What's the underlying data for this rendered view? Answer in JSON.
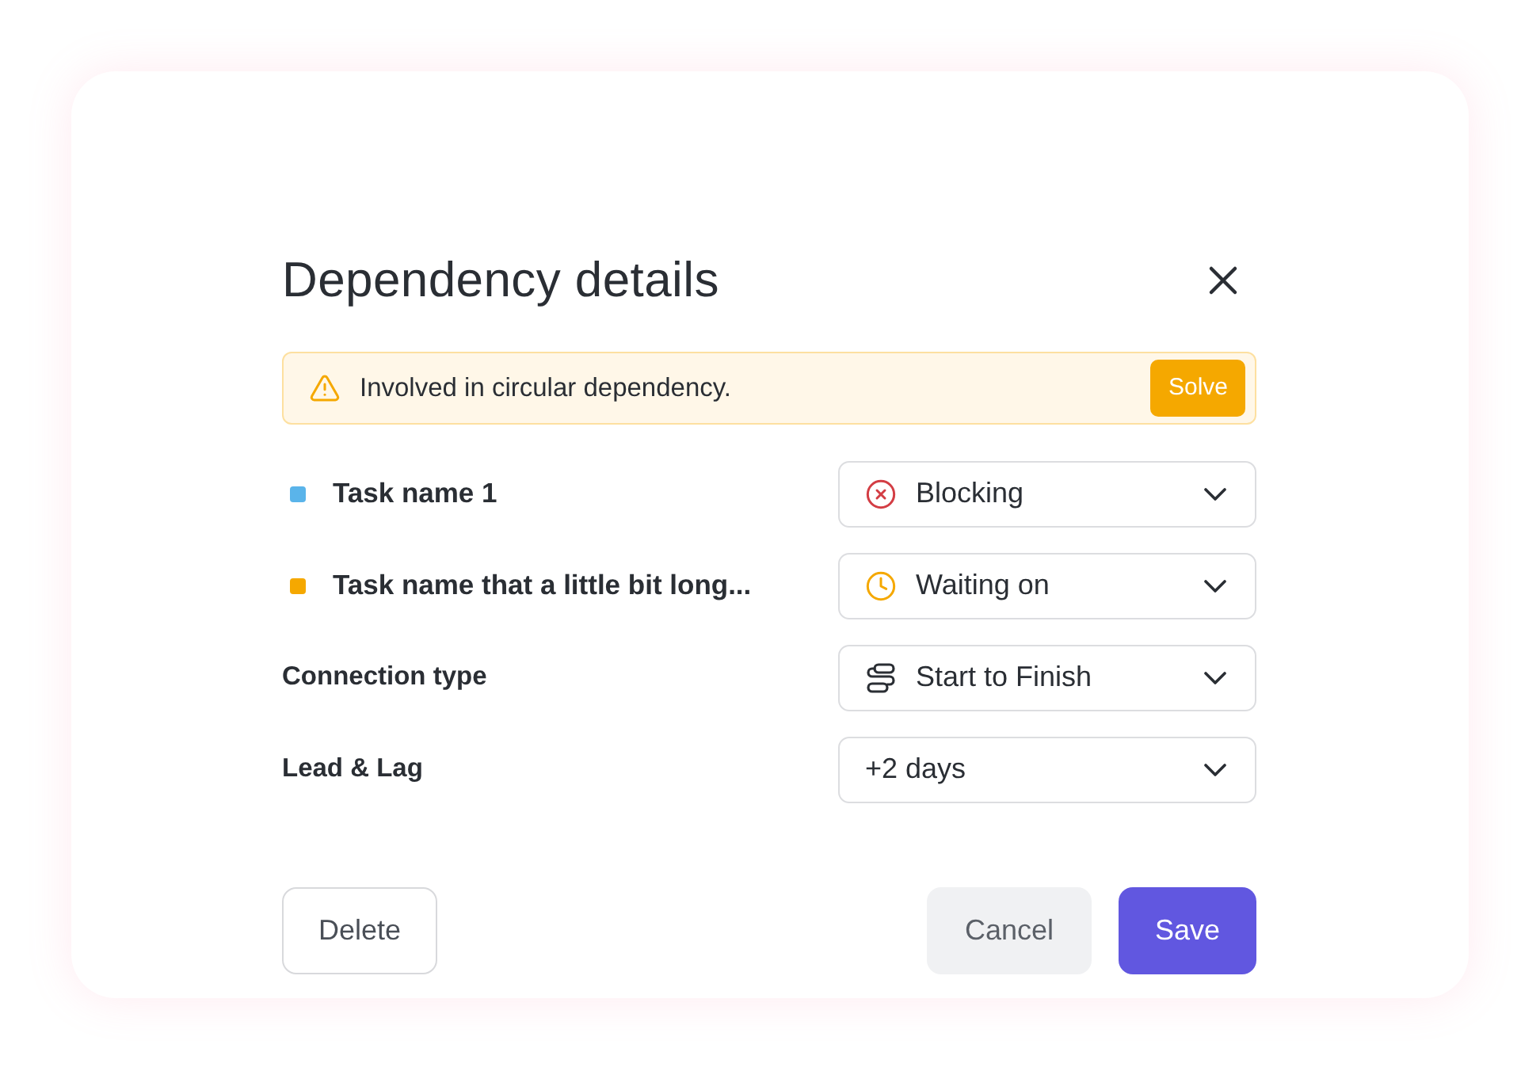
{
  "dialog": {
    "title": "Dependency details"
  },
  "alert": {
    "message": "Involved in circular dependency.",
    "action": "Solve"
  },
  "fields": [
    {
      "kind": "blocking",
      "label": "Task name 1",
      "color": "#5ab4ea",
      "value": "Blocking"
    },
    {
      "kind": "waiting",
      "label": "Task name that a little bit long...",
      "color": "#f5a800",
      "value": "Waiting on"
    },
    {
      "kind": "connection",
      "label": "Connection type",
      "value": "Start to Finish"
    },
    {
      "kind": "plain",
      "label": "Lead & Lag",
      "value": "+2 days"
    }
  ],
  "buttons": [
    {
      "kind": "outline",
      "label": "Delete"
    },
    {
      "kind": "secondary",
      "label": "Cancel"
    },
    {
      "kind": "primary",
      "label": "Save"
    }
  ]
}
